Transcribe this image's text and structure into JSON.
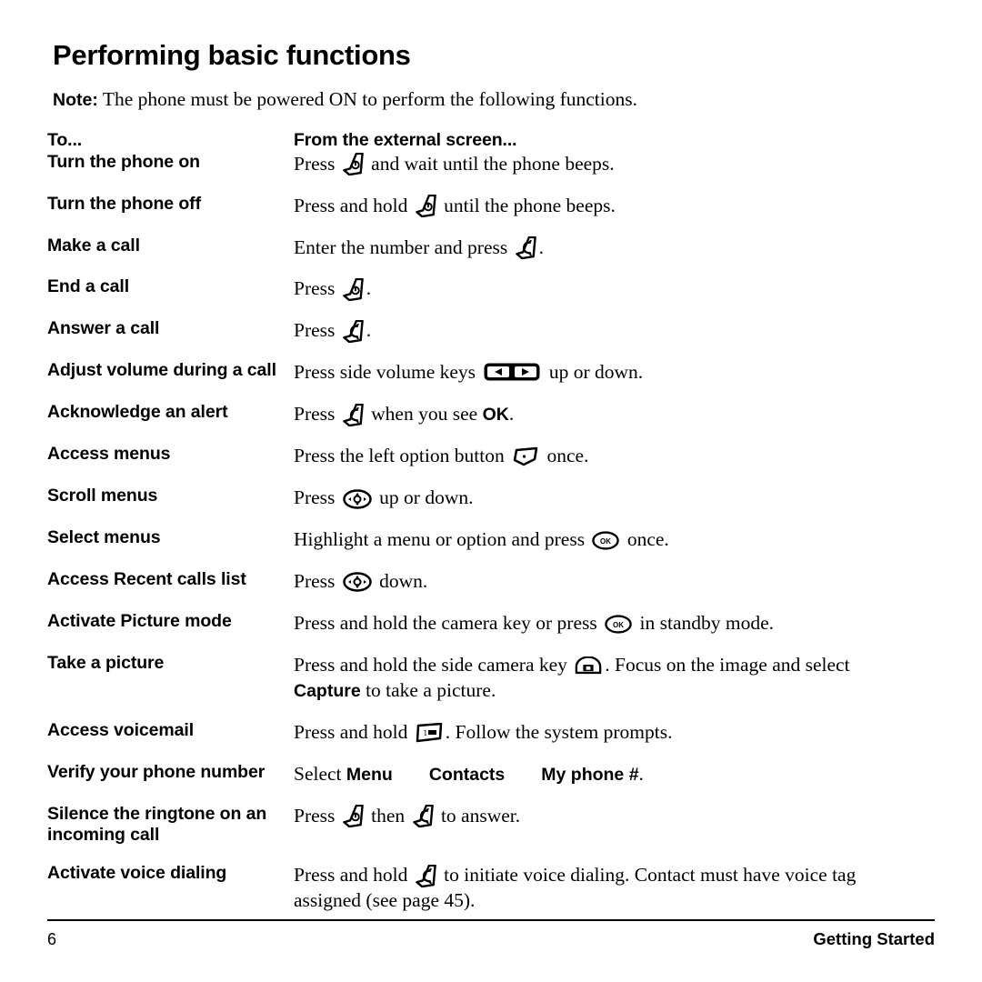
{
  "document": {
    "title": "Performing basic functions",
    "note": {
      "label": "Note:",
      "text": "The phone must be powered ON to perform the following functions."
    },
    "table": {
      "headers": {
        "column1": "To...",
        "column2": "From the external screen..."
      },
      "rows": [
        {
          "label": "Turn the phone on",
          "parts": [
            {
              "t": "text",
              "v": "Press "
            },
            {
              "t": "icon",
              "v": "power-end-key-icon"
            },
            {
              "t": "text",
              "v": " and wait until the phone beeps."
            }
          ]
        },
        {
          "label": "Turn the phone off",
          "parts": [
            {
              "t": "text",
              "v": "Press and hold "
            },
            {
              "t": "icon",
              "v": "power-end-key-icon"
            },
            {
              "t": "text",
              "v": " until the phone beeps."
            }
          ]
        },
        {
          "label": "Make a call",
          "parts": [
            {
              "t": "text",
              "v": "Enter the number and press "
            },
            {
              "t": "icon",
              "v": "send-talk-key-icon"
            },
            {
              "t": "text",
              "v": "."
            }
          ]
        },
        {
          "label": "End a call",
          "parts": [
            {
              "t": "text",
              "v": "Press "
            },
            {
              "t": "icon",
              "v": "power-end-key-icon"
            },
            {
              "t": "text",
              "v": "."
            }
          ]
        },
        {
          "label": "Answer a call",
          "parts": [
            {
              "t": "text",
              "v": "Press "
            },
            {
              "t": "icon",
              "v": "send-talk-key-icon"
            },
            {
              "t": "text",
              "v": "."
            }
          ]
        },
        {
          "label": "Adjust volume during a call",
          "parts": [
            {
              "t": "text",
              "v": "Press side volume keys "
            },
            {
              "t": "icon",
              "v": "side-volume-keys-icon"
            },
            {
              "t": "text",
              "v": " up or down."
            }
          ]
        },
        {
          "label": "Acknowledge an alert",
          "parts": [
            {
              "t": "text",
              "v": "Press "
            },
            {
              "t": "icon",
              "v": "send-talk-key-icon"
            },
            {
              "t": "text",
              "v": " when you see "
            },
            {
              "t": "bold",
              "v": "OK"
            },
            {
              "t": "text",
              "v": "."
            }
          ]
        },
        {
          "label": "Access menus",
          "parts": [
            {
              "t": "text",
              "v": "Press the left option button "
            },
            {
              "t": "icon",
              "v": "left-option-softkey-icon"
            },
            {
              "t": "text",
              "v": " once."
            }
          ]
        },
        {
          "label": "Scroll menus",
          "parts": [
            {
              "t": "text",
              "v": "Press "
            },
            {
              "t": "icon",
              "v": "navigation-key-icon"
            },
            {
              "t": "text",
              "v": " up or down."
            }
          ]
        },
        {
          "label": "Select menus",
          "parts": [
            {
              "t": "text",
              "v": "Highlight a menu or option and press "
            },
            {
              "t": "icon",
              "v": "ok-key-icon"
            },
            {
              "t": "text",
              "v": " once."
            }
          ]
        },
        {
          "label": "Access Recent calls list",
          "parts": [
            {
              "t": "text",
              "v": "Press "
            },
            {
              "t": "icon",
              "v": "navigation-key-icon"
            },
            {
              "t": "text",
              "v": " down."
            }
          ]
        },
        {
          "label": "Activate Picture mode",
          "parts": [
            {
              "t": "text",
              "v": "Press and hold the camera key or press "
            },
            {
              "t": "icon",
              "v": "ok-key-icon"
            },
            {
              "t": "text",
              "v": " in standby mode."
            }
          ]
        },
        {
          "label": "Take a picture",
          "parts": [
            {
              "t": "text",
              "v": "Press and hold the side camera key "
            },
            {
              "t": "icon",
              "v": "side-camera-key-icon"
            },
            {
              "t": "text",
              "v": ". Focus on the image and select "
            },
            {
              "t": "break",
              "v": ""
            },
            {
              "t": "bold",
              "v": "Capture"
            },
            {
              "t": "text",
              "v": " to take a picture."
            }
          ]
        },
        {
          "label": "Access voicemail",
          "parts": [
            {
              "t": "text",
              "v": "Press and hold "
            },
            {
              "t": "icon",
              "v": "voicemail-one-key-icon"
            },
            {
              "t": "text",
              "v": ". Follow the system prompts."
            }
          ]
        },
        {
          "label": "Verify your phone number",
          "parts": [
            {
              "t": "text",
              "v": "Select "
            },
            {
              "t": "bold",
              "v": "Menu"
            },
            {
              "t": "gap",
              "v": ""
            },
            {
              "t": "bold",
              "v": "Contacts"
            },
            {
              "t": "gap",
              "v": ""
            },
            {
              "t": "bold",
              "v": "My phone #"
            },
            {
              "t": "text",
              "v": "."
            }
          ]
        },
        {
          "label": "Silence the ringtone on an incoming call",
          "parts": [
            {
              "t": "text",
              "v": "Press "
            },
            {
              "t": "icon",
              "v": "power-end-key-icon"
            },
            {
              "t": "text",
              "v": " then "
            },
            {
              "t": "icon",
              "v": "send-talk-key-icon"
            },
            {
              "t": "text",
              "v": " to answer."
            }
          ]
        },
        {
          "label": "Activate voice dialing",
          "parts": [
            {
              "t": "text",
              "v": "Press and hold "
            },
            {
              "t": "icon",
              "v": "send-talk-key-icon"
            },
            {
              "t": "text",
              "v": " to initiate voice dialing. Contact must have voice tag "
            },
            {
              "t": "break",
              "v": ""
            },
            {
              "t": "text",
              "v": "assigned (see page 45)."
            }
          ]
        }
      ]
    },
    "footer": {
      "page_number": "6",
      "section": "Getting Started"
    }
  }
}
